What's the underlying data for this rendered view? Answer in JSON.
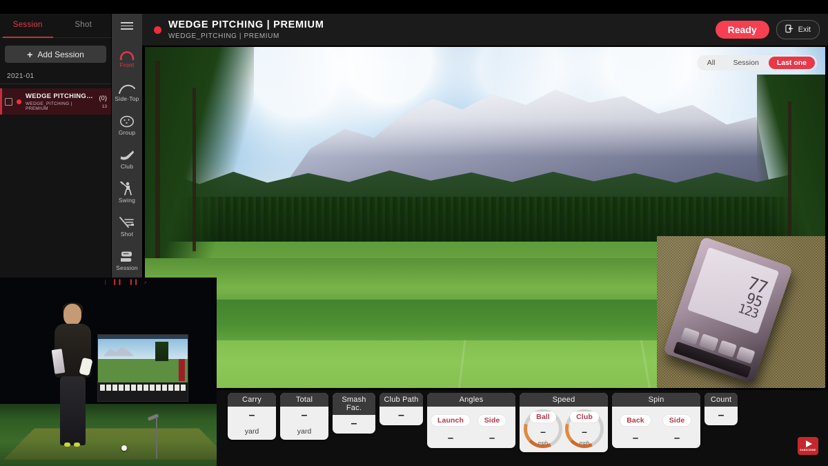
{
  "sidebar": {
    "tabs": [
      {
        "label": "Session",
        "active": true
      },
      {
        "label": "Shot",
        "active": false
      }
    ],
    "add_button": {
      "plus": "+",
      "label": "Add Session"
    },
    "date_group": "2021-01",
    "sessions": [
      {
        "title": "WEDGE PITCHING |...",
        "subtitle": "WEDGE_PITCHING | PREMIUM",
        "count": "(0)",
        "number": "13"
      }
    ]
  },
  "rail": {
    "menu_icon": "hamburger-icon",
    "items": [
      {
        "label": "Front",
        "icon": "front-arc-icon",
        "active": true
      },
      {
        "label": "Side·Top",
        "icon": "side-top-curve-icon",
        "active": false
      },
      {
        "label": "Group",
        "icon": "group-ball-icon",
        "active": false
      },
      {
        "label": "Club",
        "icon": "club-head-icon",
        "active": false
      },
      {
        "label": "Swing",
        "icon": "swing-golfer-icon",
        "active": false
      },
      {
        "label": "Shot",
        "icon": "shot-lines-icon",
        "active": false
      },
      {
        "label": "Session",
        "icon": "session-stack-icon",
        "active": false
      }
    ]
  },
  "header": {
    "status_dot": "recording-dot",
    "title": "WEDGE PITCHING | PREMIUM",
    "subtitle": "WEDGE_PITCHING | PREMIUM",
    "ready_label": "Ready",
    "exit_label": "Exit",
    "exit_icon": "exit-door-icon",
    "accent_color": "#f63f51"
  },
  "simulator": {
    "view_filters": [
      {
        "label": "All",
        "active": false
      },
      {
        "label": "Session",
        "active": false
      },
      {
        "label": "Last one",
        "active": true
      }
    ],
    "launch_monitor": {
      "readout_lines": [
        "77",
        "95",
        "123"
      ]
    }
  },
  "stats": {
    "cards": [
      {
        "title": "Carry",
        "kind": "single",
        "value": "–",
        "unit": "yard",
        "width": "w1"
      },
      {
        "title": "Total",
        "kind": "single",
        "value": "–",
        "unit": "yard",
        "width": "w1"
      },
      {
        "title": "Smash Fac.",
        "kind": "single",
        "value": "–",
        "unit": "",
        "width": "w2"
      },
      {
        "title": "Club Path",
        "kind": "single",
        "value": "–",
        "unit": "",
        "width": "w3"
      },
      {
        "title": "Angles",
        "kind": "dual",
        "width": "dual",
        "metrics": [
          {
            "label": "Launch",
            "value": "–"
          },
          {
            "label": "Side",
            "value": "–"
          }
        ]
      },
      {
        "title": "Speed",
        "kind": "gauges",
        "width": "dual",
        "metrics": [
          {
            "label": "Ball",
            "value": "–",
            "unit": "mph"
          },
          {
            "label": "Club",
            "value": "–",
            "unit": "mph"
          }
        ]
      },
      {
        "title": "Spin",
        "kind": "dual",
        "width": "dual",
        "metrics": [
          {
            "label": "Back",
            "value": "–"
          },
          {
            "label": "Side",
            "value": "–"
          }
        ]
      },
      {
        "title": "Count",
        "kind": "single",
        "value": "–",
        "unit": "",
        "width": "count"
      }
    ]
  },
  "webcam": {
    "overlay_text": "| ▌▌ ▐▐ ↗",
    "subscribe": {
      "icon": "youtube-play-icon",
      "label": "SUBSCRIBE"
    }
  }
}
